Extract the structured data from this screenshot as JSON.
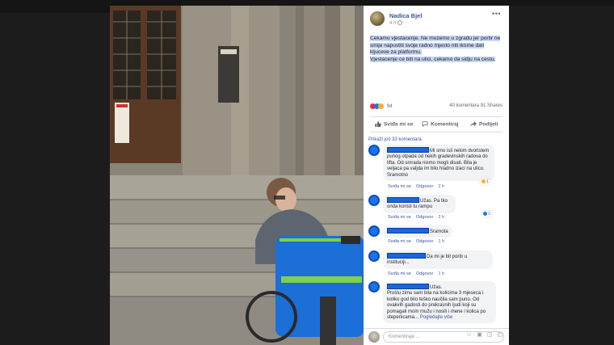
{
  "post": {
    "author": "Nadica Bjel",
    "time": "4 h",
    "more": "•••",
    "text_line1": "Cekamo vjestacenje. Ne mozemo u zgradu jer portir ne smije napustiti svoje radno mjesto niti ikome dati kljuceve za platformu.",
    "text_line2": "Vjestacenje ce biti na ulici, cekamo da sidju na cestu."
  },
  "stats": {
    "reactions_count": "94",
    "comments_shares": "40 komentara  91 Shares"
  },
  "actions": {
    "like": "Sviđa mi se",
    "comment": "Komentiraj",
    "share": "Podijeli"
  },
  "previous_comments": "Prikaži još 33 komentara",
  "comments": [
    {
      "text": "Mi smo isli nekim dvoristem punog otpada od nekih gradevinskih radova do lifta. Od smrada nismo mogli disati. Bila je veljaca pa valjda im bilo hladno izaci na ulicu. Sramotno",
      "like": "Sviđa mi se",
      "reply": "Odgovor",
      "time": "2 h",
      "reactions": "1"
    },
    {
      "text": "Užas. Pa tko onda koristi tu rampu",
      "like": "Sviđa mi se",
      "reply": "Odgovor",
      "time": "2 h",
      "reactions": "1"
    },
    {
      "text": "Sramota",
      "like": "Sviđa mi se",
      "reply": "Odgovor",
      "time": "1 h"
    },
    {
      "text": "Da mi je bit portir u instituciji...",
      "like": "Sviđa mi se",
      "reply": "Odgovor",
      "time": "1 h"
    },
    {
      "text_head": "Užas.",
      "text": "Prošlu zimu sam bila na kolicima 3 mjeseca i koliko god bilo teško naučila sam puno. Od ovakvih gadosti do prekrasnih ljudi koji su pomagali mom mužu i nosili i mene i kolica po stepenicama...",
      "see_more": "Pogledajte više"
    }
  ],
  "composer": {
    "placeholder": "Komentiraje ...",
    "icons": "☺ ▣ ◫ ◰"
  },
  "colors": {
    "link": "#385898",
    "redaction": "#1a66dd",
    "highlight": "#c7d6f2"
  }
}
